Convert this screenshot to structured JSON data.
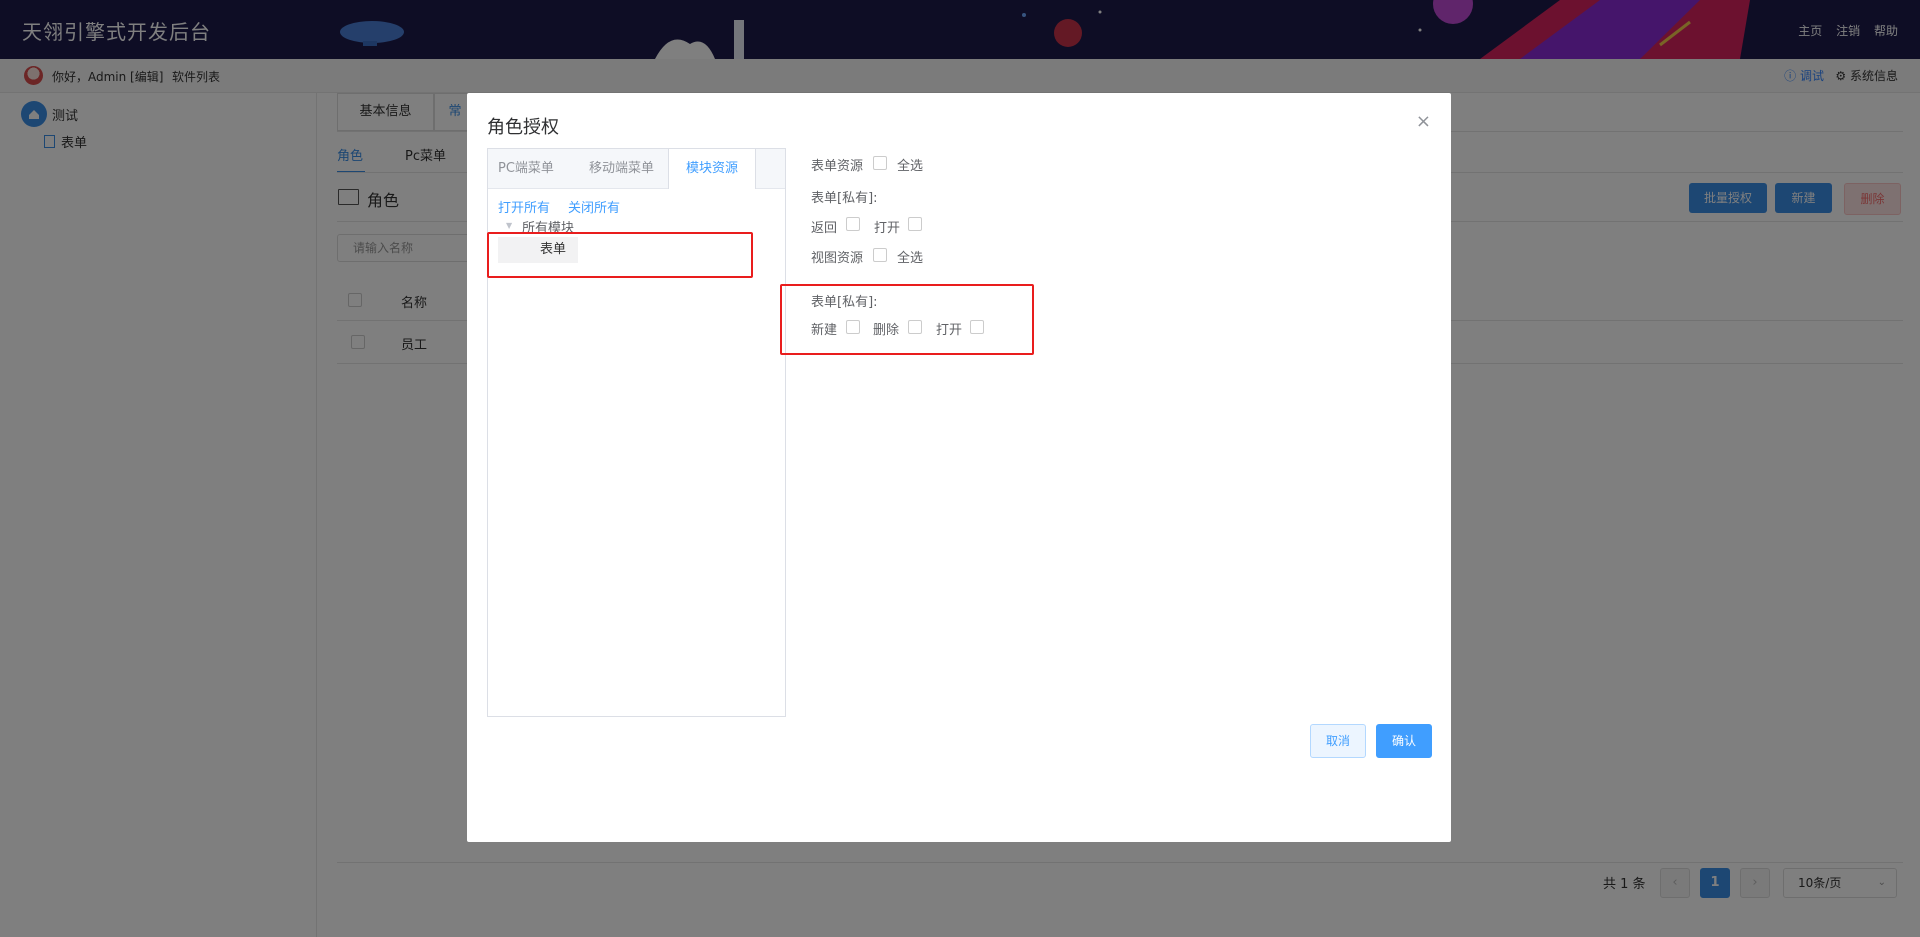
{
  "header": {
    "app_title": "天翎引擎式开发后台",
    "links": [
      "主页",
      "注销",
      "帮助"
    ]
  },
  "subbar": {
    "greeting": "你好，Admin [编辑]",
    "software_list": "软件列表",
    "debug": "ⓘ 调试",
    "system_info": "⚙ 系统信息"
  },
  "sidebar": {
    "root_label": "测试",
    "child_label": "表单"
  },
  "main": {
    "tabs": [
      "基本信息",
      "常"
    ],
    "sub_tabs": [
      "角色",
      "Pc菜单"
    ],
    "section_title": "角色",
    "search_placeholder": "请输入名称",
    "buttons": {
      "batch": "批量授权",
      "new": "新建",
      "delete": "删除"
    },
    "table": {
      "header_name": "名称",
      "rows": [
        "员工"
      ]
    },
    "pager": {
      "total": "共 1 条",
      "current_page": "1",
      "page_size": "10条/页",
      "prev": "‹",
      "next": "›"
    }
  },
  "modal": {
    "title": "角色授权",
    "close": "×",
    "tabs": [
      "PC端菜单",
      "移动端菜单",
      "模块资源"
    ],
    "active_tab": "模块资源",
    "expand_all": "打开所有",
    "collapse_all": "关闭所有",
    "tree_root": "所有模块",
    "tree_item": "表单",
    "perm": {
      "form_resources": "表单资源",
      "select_all": "全选",
      "form_private": "表单[私有]:",
      "back": "返回",
      "open": "打开",
      "view_resources": "视图资源",
      "view_private": "表单[私有]:",
      "new": "新建",
      "delete": "删除"
    },
    "cancel": "取消",
    "confirm": "确认"
  },
  "colors": {
    "accent": "#409eff",
    "highlight": "#e91d1d",
    "header_bg": "#1c1a4b"
  }
}
